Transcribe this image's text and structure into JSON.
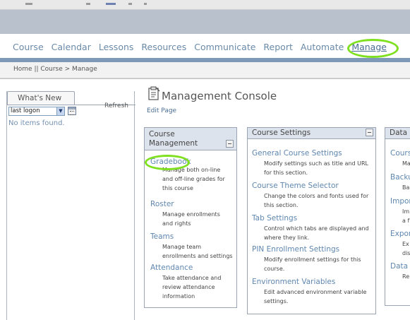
{
  "nav": {
    "items": [
      {
        "label": "Course"
      },
      {
        "label": "Calendar"
      },
      {
        "label": "Lessons"
      },
      {
        "label": "Resources"
      },
      {
        "label": "Communicate"
      },
      {
        "label": "Report"
      },
      {
        "label": "Automate"
      },
      {
        "label": "Manage",
        "active": true
      }
    ]
  },
  "breadcrumb": "Home || Course > Manage",
  "whats_new": {
    "tab_label": "What's New",
    "refresh_label": "Refresh",
    "filter_value": "last logon",
    "empty_text": "No items found."
  },
  "console": {
    "title": "Management Console",
    "edit_page": "Edit Page"
  },
  "panels": {
    "course_management": {
      "title": "Course Management",
      "items": [
        {
          "link": "Gradebook",
          "desc": "Manage both on-line and off-line grades for this course"
        },
        {
          "link": "Roster",
          "desc": "Manage enrollments and rights"
        },
        {
          "link": "Teams",
          "desc": "Manage team enrollments and settings"
        },
        {
          "link": "Attendance",
          "desc": "Take attendance and review attendance information"
        }
      ]
    },
    "course_settings": {
      "title": "Course Settings",
      "items": [
        {
          "link": "General Course Settings",
          "desc": "Modify settings such as title and URL for this section."
        },
        {
          "link": "Course Theme Selector",
          "desc": "Change the colors and fonts used for this section."
        },
        {
          "link": "Tab Settings",
          "desc": "Control which tabs are displayed and where they link."
        },
        {
          "link": "PIN Enrollment Settings",
          "desc": "Modify enrollment settings for this course."
        },
        {
          "link": "Environment Variables",
          "desc": "Edit advanced environment variable settings."
        }
      ]
    },
    "data": {
      "title": "Data I",
      "items": [
        {
          "link": "Cours",
          "desc": "Ma"
        },
        {
          "link": "Backu",
          "desc": "Ba"
        },
        {
          "link": "Impor",
          "desc": "Im a f"
        },
        {
          "link": "Expor",
          "desc": "Ex dis"
        },
        {
          "link": "Data",
          "desc": "Re"
        }
      ]
    }
  },
  "colors": {
    "highlight": "#7ee01f",
    "nav_text": "#6a8aa8",
    "link": "#5f87b0",
    "nav_bar": "#7e98b8",
    "band": "#b9c1cc"
  }
}
